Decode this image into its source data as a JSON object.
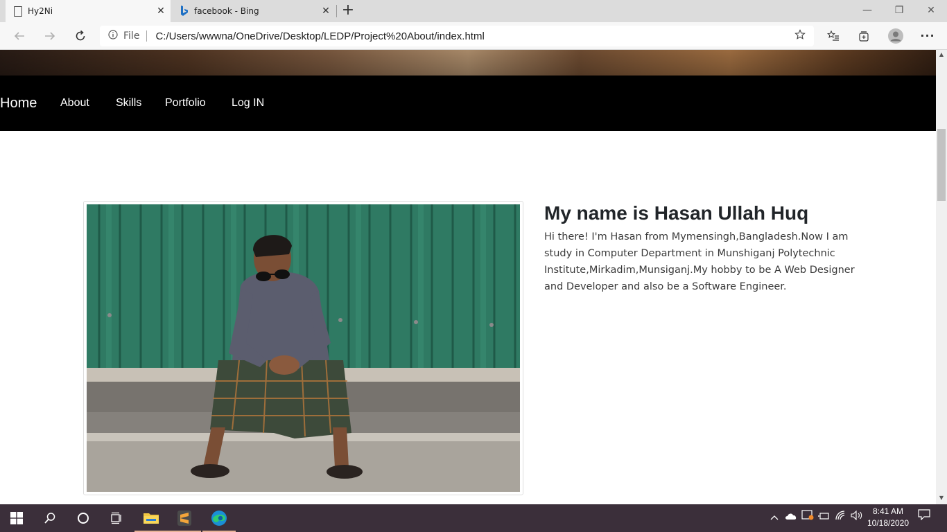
{
  "browser": {
    "tabs": [
      {
        "title": "Hy2Ni",
        "icon": "page-icon",
        "active": true
      },
      {
        "title": "facebook - Bing",
        "icon": "bing-icon",
        "active": false
      }
    ],
    "new_tab_glyph": "+",
    "close_glyph": "✕",
    "address": {
      "scheme_label": "File",
      "url": "C:/Users/wwwna/OneDrive/Desktop/LEDP/Project%20About/index.html"
    },
    "window_controls": {
      "minimize": "—",
      "restore": "❐",
      "close": "✕"
    }
  },
  "site": {
    "nav": {
      "brand": "Home",
      "links": [
        "About",
        "Skills",
        "Portfolio",
        "Log IN"
      ]
    },
    "about": {
      "title": "My name is Hasan Ullah Huq",
      "text": "Hi there! I'm Hasan from Mymensingh,Bangladesh.Now I am study in Computer Department in Munshiganj Polytechnic Institute,Mirkadim,Munsiganj.My hobby to be A Web Designer and Developer and also be a Software Engineer."
    }
  },
  "taskbar": {
    "clock_time": "8:41 AM",
    "clock_date": "10/18/2020",
    "colors": {
      "background": "#3b2f3a",
      "running_indicator": "#e8b298"
    }
  }
}
